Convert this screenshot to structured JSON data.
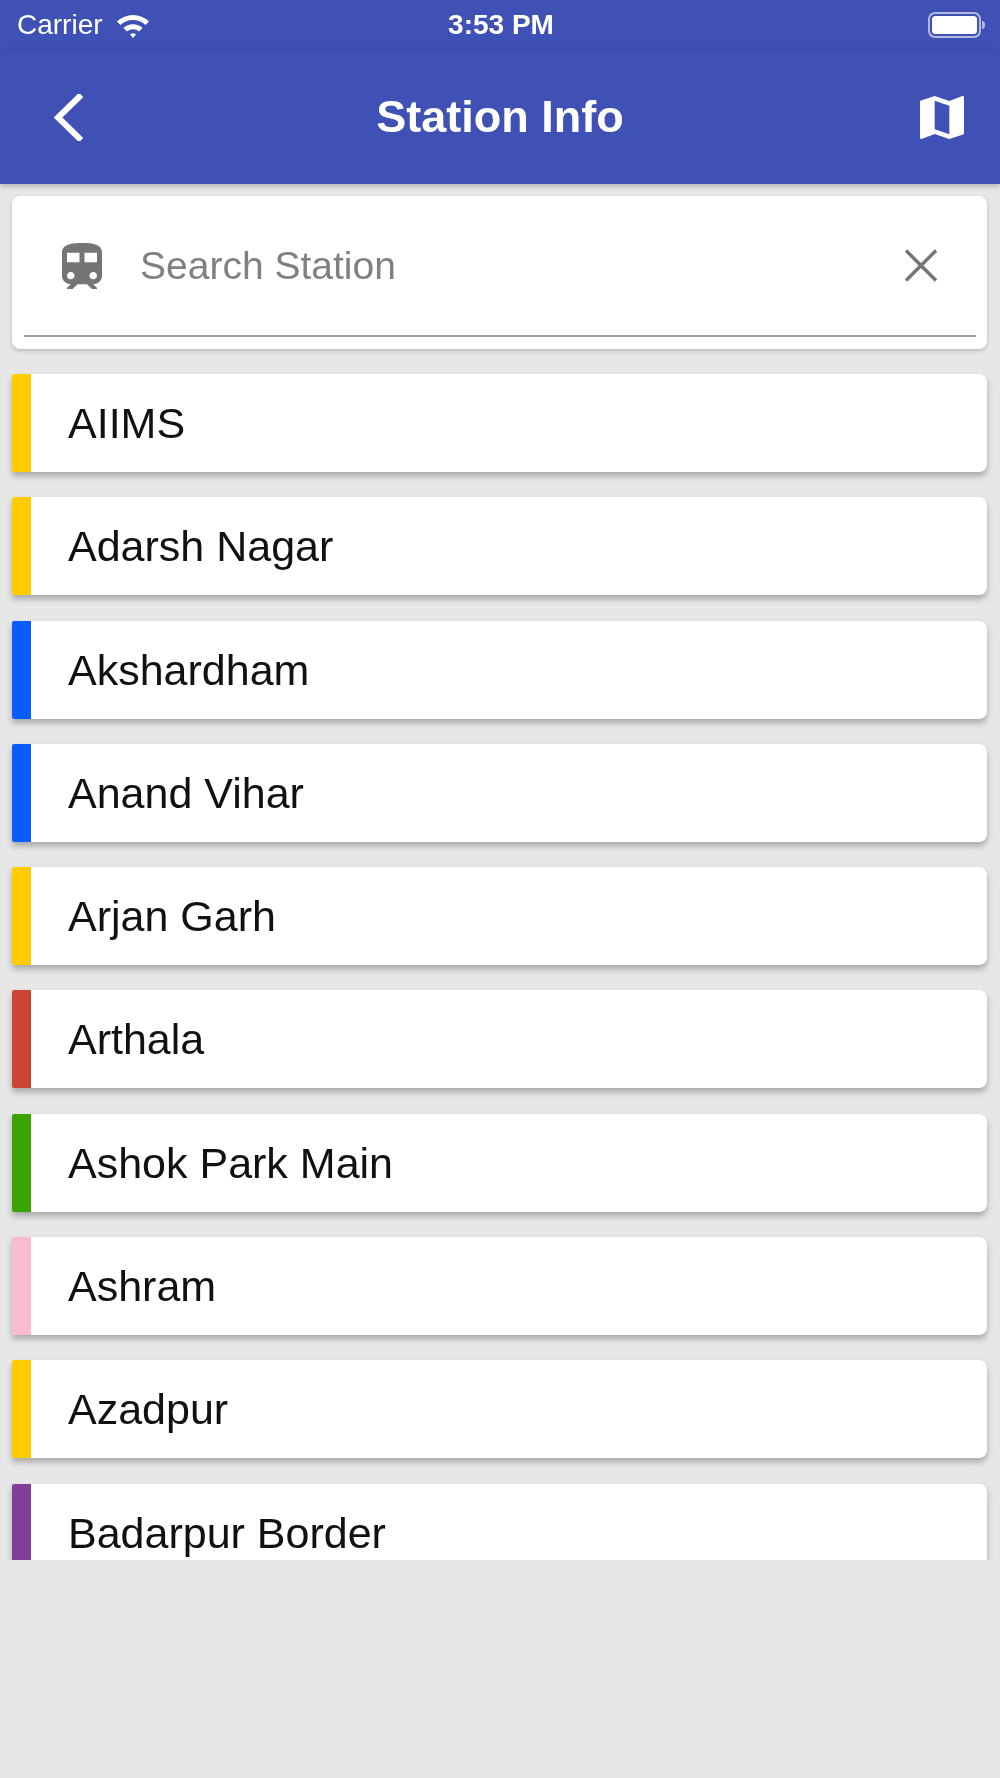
{
  "status_bar": {
    "carrier": "Carrier",
    "time": "3:53 PM"
  },
  "header": {
    "title": "Station Info"
  },
  "search": {
    "placeholder": "Search Station"
  },
  "stations": [
    {
      "name": "AIIMS",
      "color": "#ffcc00"
    },
    {
      "name": "Adarsh Nagar",
      "color": "#ffcc00"
    },
    {
      "name": "Akshardham",
      "color": "#0a5cff"
    },
    {
      "name": "Anand Vihar",
      "color": "#0a5cff"
    },
    {
      "name": "Arjan Garh",
      "color": "#ffcc00"
    },
    {
      "name": "Arthala",
      "color": "#cc4533"
    },
    {
      "name": "Ashok Park Main",
      "color": "#3aa300"
    },
    {
      "name": "Ashram",
      "color": "#f8bbd0"
    },
    {
      "name": "Azadpur",
      "color": "#ffcc00"
    },
    {
      "name": "Badarpur Border",
      "color": "#7f3f98"
    }
  ]
}
